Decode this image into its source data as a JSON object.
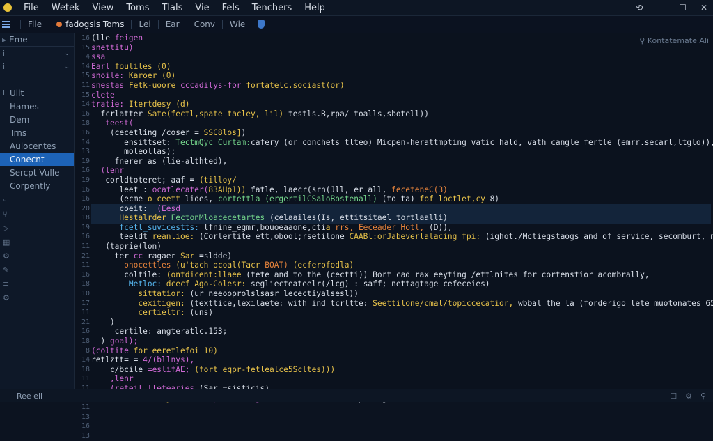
{
  "menu": [
    "File",
    "Wetek",
    "View",
    "Toms",
    "Tlals",
    "Vie",
    "Fels",
    "Tenchers",
    "Help"
  ],
  "tabs": {
    "file": "File",
    "active": "fadogsis Toms",
    "items": [
      "Lei",
      "Ear",
      "Conv",
      "Wie"
    ]
  },
  "sidebar": {
    "top_label": "Eme",
    "items": [
      {
        "mark": "i",
        "label": "",
        "chevron": true
      },
      {
        "mark": "i",
        "label": "",
        "chevron": true
      },
      {
        "mark": "",
        "label": "",
        "chevron": false
      },
      {
        "mark": "i",
        "label": "Ullt",
        "chevron": false
      },
      {
        "mark": "",
        "label": "Hames",
        "chevron": false
      },
      {
        "mark": "",
        "label": "Dem",
        "chevron": false
      },
      {
        "mark": "",
        "label": "Trns",
        "chevron": false
      },
      {
        "mark": "",
        "label": "Aulocentes",
        "chevron": false
      },
      {
        "mark": "",
        "label": "Conecnt",
        "chevron": false,
        "active": true
      },
      {
        "mark": "",
        "label": "Sercpt Vulle",
        "chevron": false
      },
      {
        "mark": "",
        "label": "Corpently",
        "chevron": false
      }
    ]
  },
  "editor": {
    "breadcrumb": "Kontatemate Ali",
    "line_numbers": [
      "16",
      "15",
      "4",
      "14",
      "15",
      "11",
      "15",
      "14",
      "16",
      "18",
      "16",
      "14",
      "13",
      "19",
      "16",
      "19",
      "16",
      "16",
      "20",
      "18",
      "19",
      "16",
      "11",
      "21",
      "11",
      "16",
      "18",
      "10",
      "17",
      "11",
      "21",
      "16",
      "18",
      "8",
      "14",
      "18",
      "11",
      "11",
      "10",
      "11",
      "13",
      "16",
      "13"
    ],
    "lines": [
      [
        {
          "t": "(lle ",
          "c": "pl"
        },
        {
          "t": "feigen",
          "c": "kw"
        }
      ],
      [
        {
          "t": "snettitu)",
          "c": "kw"
        }
      ],
      [
        {
          "t": "ssa",
          "c": "kw"
        }
      ],
      [
        {
          "t": "Earl ",
          "c": "kw"
        },
        {
          "t": "fouliles (0)",
          "c": "fn"
        }
      ],
      [
        {
          "t": "snoile: ",
          "c": "kw"
        },
        {
          "t": "Karoer (0)",
          "c": "fn"
        }
      ],
      [
        {
          "t": "snestas ",
          "c": "kw"
        },
        {
          "t": "Fetk-uoore ",
          "c": "fn"
        },
        {
          "t": "cccadilys-for ",
          "c": "kw"
        },
        {
          "t": "fortatelc.sociast(or)",
          "c": "fn"
        }
      ],
      [
        {
          "t": "clete",
          "c": "kw"
        }
      ],
      [
        {
          "t": "tratie: ",
          "c": "kw"
        },
        {
          "t": "Itertdesy (d)",
          "c": "fn"
        }
      ],
      [
        {
          "t": "  fcrlatter ",
          "c": "pl"
        },
        {
          "t": "Sate(fectl,spate tacley, lil) ",
          "c": "fn"
        },
        {
          "t": "testls.B,rpa/ ",
          "c": "pl"
        },
        {
          "t": "toalls,sbotell))",
          "c": "pl"
        }
      ],
      [
        {
          "t": "   teest(",
          "c": "kw"
        }
      ],
      [
        {
          "t": "    (cecetling /coser = ",
          "c": "pl"
        },
        {
          "t": "SSC8los]",
          "c": "fn"
        },
        {
          "t": ")",
          "c": "pl"
        }
      ],
      [
        {
          "t": "       ensittset: ",
          "c": "pl"
        },
        {
          "t": "TectmQyc Curtam:",
          "c": "str"
        },
        {
          "t": "cafery (or conchets tlteo) Micpen-herattmpting vatic hald, vath cangle fertle (emrr.secarl,ltglo)),",
          "c": "pl"
        }
      ],
      [
        {
          "t": "       moleollas);",
          "c": "pl"
        }
      ],
      [
        {
          "t": "     fnerer as (lie-althted),",
          "c": "pl"
        }
      ],
      [
        {
          "t": "  (lenr",
          "c": "kw"
        }
      ],
      [
        {
          "t": "   corldtoteret; ",
          "c": "pl"
        },
        {
          "t": "aaf = ",
          "c": "pl"
        },
        {
          "t": "(tilloy/",
          "c": "fn"
        }
      ],
      [
        {
          "t": "      leet : ",
          "c": "pl"
        },
        {
          "t": "ocatlecater(",
          "c": "kw"
        },
        {
          "t": "83AHp1)) ",
          "c": "fn"
        },
        {
          "t": "fatle, laecr(srn(Jll,_er all, ",
          "c": "pl"
        },
        {
          "t": "feceteneC(3)",
          "c": "var"
        }
      ],
      [
        {
          "t": "      (ecme ",
          "c": "pl"
        },
        {
          "t": "o ceett ",
          "c": "fn"
        },
        {
          "t": "lides, ",
          "c": "pl"
        },
        {
          "t": "cortettla (ergertilCSaloBostenall) ",
          "c": "str"
        },
        {
          "t": "(to ta) ",
          "c": "pl"
        },
        {
          "t": "fof loctlet,cy ",
          "c": "fn"
        },
        {
          "t": "8)",
          "c": "pl"
        }
      ],
      [
        {
          "t": "      coeit:  ",
          "c": "pl"
        },
        {
          "t": "(Eesd",
          "c": "kw"
        }
      ],
      [
        {
          "t": "      ",
          "c": "pl"
        },
        {
          "t": "Hestalrder ",
          "c": "fn"
        },
        {
          "t": "FectonMloacecetartes ",
          "c": "str"
        },
        {
          "t": "(celaailes(Is, ettitsitael ",
          "c": "pl"
        },
        {
          "t": "tortlaalli)",
          "c": "pl"
        }
      ],
      [
        {
          "t": "      fcetl_suvicestts: ",
          "c": "type"
        },
        {
          "t": "lfnine_egmr,bouoeaaone,cti",
          "c": "pl"
        },
        {
          "t": "a ",
          "c": "fn"
        },
        {
          "t": "rrs, Eeceader Hotl, ",
          "c": "var"
        },
        {
          "t": "(D)),",
          "c": "pl"
        }
      ],
      [
        {
          "t": "      teeldt ",
          "c": "pl"
        },
        {
          "t": "reanlioe: ",
          "c": "fn"
        },
        {
          "t": "(Corlertite ett,obool;rsetilone ",
          "c": "pl"
        },
        {
          "t": "CAABl:orJabeverlalacing fpi: ",
          "c": "fn"
        },
        {
          "t": "(ighot./Mctiegstaogs and of service, secomburt, nectage:",
          "c": "pl"
        }
      ],
      [
        {
          "t": "   (taprie(lon)",
          "c": "pl"
        }
      ],
      [
        {
          "t": "     ter ",
          "c": "pl"
        },
        {
          "t": "cc ",
          "c": "kw"
        },
        {
          "t": "ragaer ",
          "c": "pl"
        },
        {
          "t": "Sar ",
          "c": "fn"
        },
        {
          "t": "=sldde)",
          "c": "pl"
        }
      ],
      [
        {
          "t": "       onocettles ",
          "c": "var"
        },
        {
          "t": "(u'tach ocoal(Tacr ",
          "c": "fn"
        },
        {
          "t": "BOAT) ",
          "c": "var"
        },
        {
          "t": "(ecferofodla)",
          "c": "fn"
        }
      ],
      [
        {
          "t": "       coltile: ",
          "c": "pl"
        },
        {
          "t": "(ontdicent:llaee ",
          "c": "fn"
        },
        {
          "t": "(tete and to the (cectti))",
          "c": "pl"
        },
        {
          "t": " Bort cad rax eeyting /ettlnites for cortenstior acombrally,",
          "c": "pl"
        }
      ],
      [
        {
          "t": "        Metloc: ",
          "c": "type"
        },
        {
          "t": "dcecf Ago-Colesr: ",
          "c": "fn"
        },
        {
          "t": "segliecteateelr(/lcg) : ",
          "c": "pl"
        },
        {
          "t": "saff; nettagtage cefeceies)",
          "c": "pl"
        }
      ],
      [
        {
          "t": "          sittatior: ",
          "c": "fn"
        },
        {
          "t": "(ur neeooprolslsasr lecectiyalsesl))",
          "c": "pl"
        }
      ],
      [
        {
          "t": "          cexitigen: ",
          "c": "fn"
        },
        {
          "t": "(texttice,lexilaete: ",
          "c": "pl"
        },
        {
          "t": "with ind tcrltte: ",
          "c": "pl"
        },
        {
          "t": "Seettilone/cmal/topiccecatior, ",
          "c": "fn"
        },
        {
          "t": "wbbal the la (forderigo lete muotonates 65.",
          "c": "pl"
        }
      ],
      [
        {
          "t": "          certieltr: ",
          "c": "fn"
        },
        {
          "t": "(uns)",
          "c": "pl"
        }
      ],
      [
        {
          "t": "    )",
          "c": "pl"
        }
      ],
      [
        {
          "t": "     certile: ",
          "c": "pl"
        },
        {
          "t": "angteratlc.153;",
          "c": "pl"
        }
      ],
      [
        {
          "t": "  ) ",
          "c": "pl"
        },
        {
          "t": "goal);",
          "c": "kw"
        }
      ],
      [
        {
          "t": "(coltite ",
          "c": "kw"
        },
        {
          "t": "for_eeretlefoi 10)",
          "c": "fn"
        }
      ],
      [
        {
          "t": "retlztt= = ",
          "c": "pl"
        },
        {
          "t": "4/(bllnys),",
          "c": "kw"
        }
      ],
      [
        {
          "t": "    c/bcile ",
          "c": "pl"
        },
        {
          "t": "=eslifAE; ",
          "c": "kw"
        },
        {
          "t": "(fort eqpr-fetlealce5Scltes)))",
          "c": "fn"
        }
      ],
      [
        {
          "t": "    ,lenr",
          "c": "kw"
        }
      ],
      [
        {
          "t": "    (reteil lletearies ",
          "c": "kw"
        },
        {
          "t": "(Sar =sisticis)",
          "c": "pl"
        }
      ],
      [
        {
          "t": "      fales ",
          "c": "pl"
        },
        {
          "t": "foreynateti:; ",
          "c": "fn"
        },
        {
          "t": "prrleliing(,",
          "c": "kw"
        },
        {
          "t": "(Fetre ter ",
          "c": "fn"
        },
        {
          "t": "aarl.steptileg))",
          "c": "pl"
        }
      ]
    ]
  },
  "status": {
    "left": "Ree ell",
    "right": [
      "☐",
      "⚙",
      "⚲"
    ]
  },
  "window_controls": [
    "⟲",
    "—",
    "☐",
    "✕"
  ],
  "colors": {
    "accent": "#1d63b7",
    "keyword": "#d16ad6",
    "function": "#e7c24a",
    "string": "#74d58b",
    "variable": "#e8843c",
    "type": "#56b6f0"
  }
}
